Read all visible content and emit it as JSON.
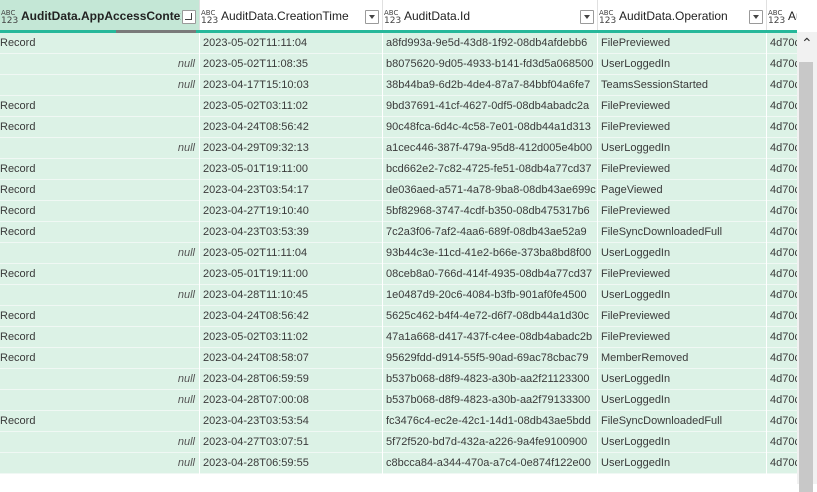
{
  "columns": [
    {
      "type_top": "ABC",
      "type_bottom": "123",
      "name": "AuditData.AppAccessContext",
      "selected": true
    },
    {
      "type_top": "ABC",
      "type_bottom": "123",
      "name": "AuditData.CreationTime",
      "selected": false
    },
    {
      "type_top": "ABC",
      "type_bottom": "123",
      "name": "AuditData.Id",
      "selected": false
    },
    {
      "type_top": "ABC",
      "type_bottom": "123",
      "name": "AuditData.Operation",
      "selected": false
    },
    {
      "type_top": "ABC",
      "type_bottom": "123",
      "name": "AuditD",
      "selected": false
    }
  ],
  "rows": [
    {
      "context": "Record",
      "context_null": false,
      "time": "2023-05-02T11:11:04",
      "id": "a8fd993a-9e5d-43d8-1f92-08db4afdebb6",
      "operation": "FilePreviewed",
      "extra": "4d70c"
    },
    {
      "context": "null",
      "context_null": true,
      "time": "2023-05-02T11:08:35",
      "id": "b8075620-9d05-4933-b141-fd3d5a068500",
      "operation": "UserLoggedIn",
      "extra": "4d70c"
    },
    {
      "context": "null",
      "context_null": true,
      "time": "2023-04-17T15:10:03",
      "id": "38b44ba9-6d2b-4de4-87a7-84bbf04a6fe7",
      "operation": "TeamsSessionStarted",
      "extra": "4d70c"
    },
    {
      "context": "Record",
      "context_null": false,
      "time": "2023-05-02T03:11:02",
      "id": "9bd37691-41cf-4627-0df5-08db4abadc2a",
      "operation": "FilePreviewed",
      "extra": "4d70c"
    },
    {
      "context": "Record",
      "context_null": false,
      "time": "2023-04-24T08:56:42",
      "id": "90c48fca-6d4c-4c58-7e01-08db44a1d313",
      "operation": "FilePreviewed",
      "extra": "4d70c"
    },
    {
      "context": "null",
      "context_null": true,
      "time": "2023-04-29T09:32:13",
      "id": "a1cec446-387f-479a-95d8-412d005e4b00",
      "operation": "UserLoggedIn",
      "extra": "4d70c"
    },
    {
      "context": "Record",
      "context_null": false,
      "time": "2023-05-01T19:11:00",
      "id": "bcd662e2-7c82-4725-fe51-08db4a77cd37",
      "operation": "FilePreviewed",
      "extra": "4d70c"
    },
    {
      "context": "Record",
      "context_null": false,
      "time": "2023-04-23T03:54:17",
      "id": "de036aed-a571-4a78-9ba8-08db43ae699c",
      "operation": "PageViewed",
      "extra": "4d70c"
    },
    {
      "context": "Record",
      "context_null": false,
      "time": "2023-04-27T19:10:40",
      "id": "5bf82968-3747-4cdf-b350-08db475317b6",
      "operation": "FilePreviewed",
      "extra": "4d70c"
    },
    {
      "context": "Record",
      "context_null": false,
      "time": "2023-04-23T03:53:39",
      "id": "7c2a3f06-7af2-4aa6-689f-08db43ae52a9",
      "operation": "FileSyncDownloadedFull",
      "extra": "4d70c"
    },
    {
      "context": "null",
      "context_null": true,
      "time": "2023-05-02T11:11:04",
      "id": "93b44c3e-11cd-41e2-b66e-373ba8bd8f00",
      "operation": "UserLoggedIn",
      "extra": "4d70c"
    },
    {
      "context": "Record",
      "context_null": false,
      "time": "2023-05-01T19:11:00",
      "id": "08ceb8a0-766d-414f-4935-08db4a77cd37",
      "operation": "FilePreviewed",
      "extra": "4d70c"
    },
    {
      "context": "null",
      "context_null": true,
      "time": "2023-04-28T11:10:45",
      "id": "1e0487d9-20c6-4084-b3fb-901af0fe4500",
      "operation": "UserLoggedIn",
      "extra": "4d70c"
    },
    {
      "context": "Record",
      "context_null": false,
      "time": "2023-04-24T08:56:42",
      "id": "5625c462-b4f4-4e72-d6f7-08db44a1d30c",
      "operation": "FilePreviewed",
      "extra": "4d70c"
    },
    {
      "context": "Record",
      "context_null": false,
      "time": "2023-05-02T03:11:02",
      "id": "47a1a668-d417-437f-c4ee-08db4abadc2b",
      "operation": "FilePreviewed",
      "extra": "4d70c"
    },
    {
      "context": "Record",
      "context_null": false,
      "time": "2023-04-24T08:58:07",
      "id": "95629fdd-d914-55f5-90ad-69ac78cbac79",
      "operation": "MemberRemoved",
      "extra": "4d70c"
    },
    {
      "context": "null",
      "context_null": true,
      "time": "2023-04-28T06:59:59",
      "id": "b537b068-d8f9-4823-a30b-aa2f21123300",
      "operation": "UserLoggedIn",
      "extra": "4d70c"
    },
    {
      "context": "null",
      "context_null": true,
      "time": "2023-04-28T07:00:08",
      "id": "b537b068-d8f9-4823-a30b-aa2f79133300",
      "operation": "UserLoggedIn",
      "extra": "4d70c"
    },
    {
      "context": "Record",
      "context_null": false,
      "time": "2023-04-23T03:53:54",
      "id": "fc3476c4-ec2e-42c1-14d1-08db43ae5bdd",
      "operation": "FileSyncDownloadedFull",
      "extra": "4d70c"
    },
    {
      "context": "null",
      "context_null": true,
      "time": "2023-04-27T03:07:51",
      "id": "5f72f520-bd7d-432a-a226-9a4fe9100900",
      "operation": "UserLoggedIn",
      "extra": "4d70c"
    },
    {
      "context": "null",
      "context_null": true,
      "time": "2023-04-28T06:59:55",
      "id": "c8bcca84-a344-470a-a7c4-0e874f122e00",
      "operation": "UserLoggedIn",
      "extra": "4d70c"
    }
  ],
  "colors": {
    "row_bg": "#dcf2e6",
    "selected_header_bg": "#c4e7d6",
    "quality_bar": "#26b89a"
  },
  "scrollbar": {
    "up_arrow_icon": "chevron-up-icon"
  }
}
